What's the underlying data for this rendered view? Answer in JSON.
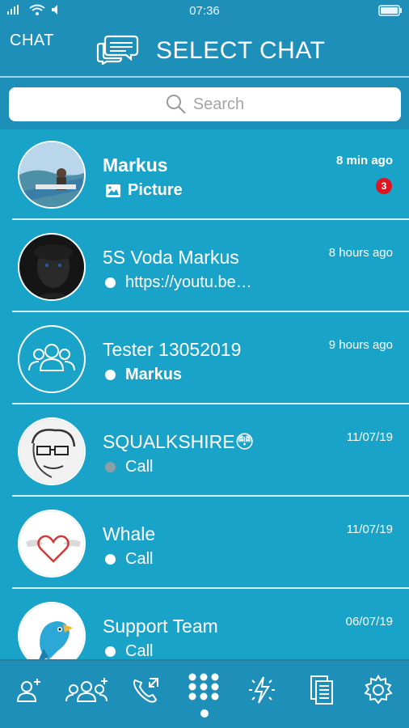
{
  "status_bar": {
    "time": "07:36",
    "signal": "signal-icon",
    "wifi": "wifi-icon",
    "battery": "battery-icon"
  },
  "header": {
    "left_label": "CHAT",
    "title": "SELECT CHAT",
    "icon": "chat-bubbles-icon"
  },
  "search": {
    "placeholder": "Search"
  },
  "chats": [
    {
      "name": "Markus",
      "preview": "Picture",
      "preview_icon": "picture-icon",
      "time": "8 min ago",
      "badge": "3",
      "unread": true
    },
    {
      "name": "5S Voda Markus",
      "preview": "https://youtu.be…",
      "time": "8 hours ago"
    },
    {
      "name": "Tester 13052019",
      "preview": "Markus",
      "time": "9 hours ago",
      "group": true
    },
    {
      "name": "SQUALKSHIRE😳",
      "preview": "Call",
      "time": "11/07/19",
      "status": "grey"
    },
    {
      "name": "Whale",
      "preview": "Call",
      "time": "11/07/19"
    },
    {
      "name": "Support Team",
      "preview": "Call",
      "time": "06/07/19"
    }
  ],
  "bottom_nav": [
    "add-contact-icon",
    "add-group-icon",
    "call-history-icon",
    "dialpad-icon",
    "flash-icon",
    "documents-icon",
    "settings-icon"
  ],
  "colors": {
    "background": "#19A3C8",
    "header": "#1E8FB8",
    "badge": "#E0141E"
  }
}
